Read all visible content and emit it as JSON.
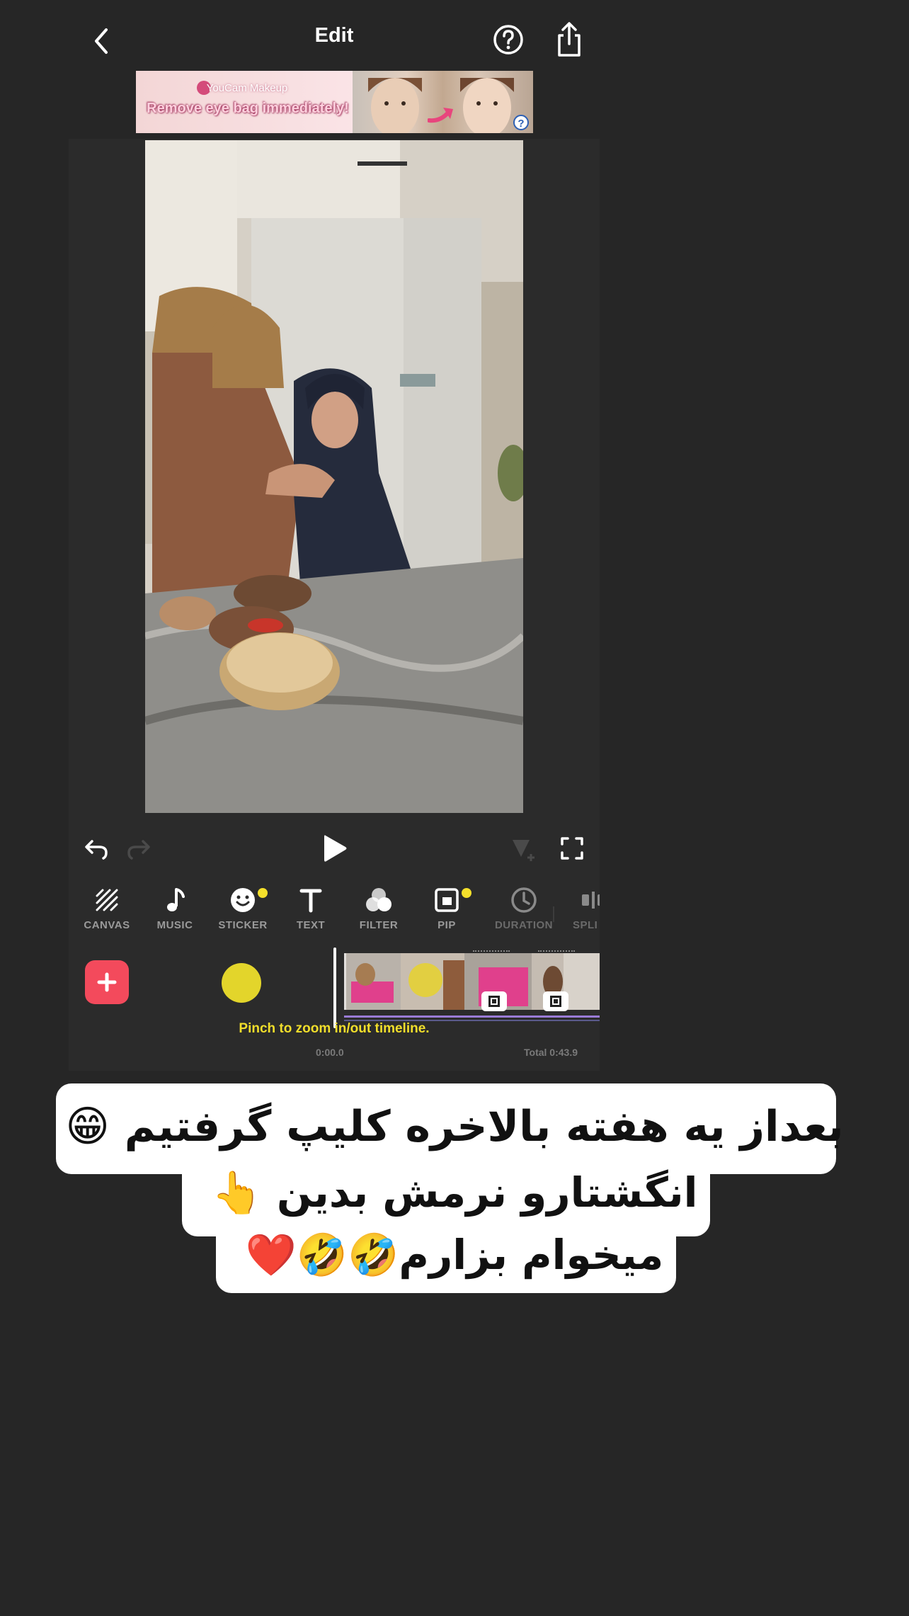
{
  "header": {
    "title": "Edit"
  },
  "ad": {
    "brand": "YouCam Makeup",
    "headline": "Remove eye bag immediately!",
    "info_glyph": "?"
  },
  "toolbar": {
    "items": [
      {
        "label": "CANVAS",
        "icon": "canvas-icon",
        "badge": false
      },
      {
        "label": "MUSIC",
        "icon": "music-note-icon",
        "badge": false
      },
      {
        "label": "STICKER",
        "icon": "sticker-smiley-icon",
        "badge": true
      },
      {
        "label": "TEXT",
        "icon": "text-t-icon",
        "badge": false
      },
      {
        "label": "FILTER",
        "icon": "filter-circles-icon",
        "badge": false
      },
      {
        "label": "PIP",
        "icon": "pip-icon",
        "badge": true
      },
      {
        "label": "DURATION",
        "icon": "clock-icon",
        "badge": false
      },
      {
        "label": "SPLI",
        "icon": "split-icon",
        "badge": false
      }
    ]
  },
  "timeline": {
    "hint": "Pinch to zoom in/out timeline.",
    "current_time": "0:00.0",
    "total": "Total 0:43.9"
  },
  "caption": {
    "line1": "بعداز یه هفته بالاخره کلیپ گرفتیم 😁",
    "line2": "انگشتارو نرمش بدین 👆",
    "line3": "میخوام بزارم🤣🤣❤️"
  },
  "colors": {
    "background": "#262626",
    "panel": "#2b2b2b",
    "accent_red": "#f34a5c",
    "badge_yellow": "#f5e02b",
    "hint_yellow": "#f1de2b"
  }
}
